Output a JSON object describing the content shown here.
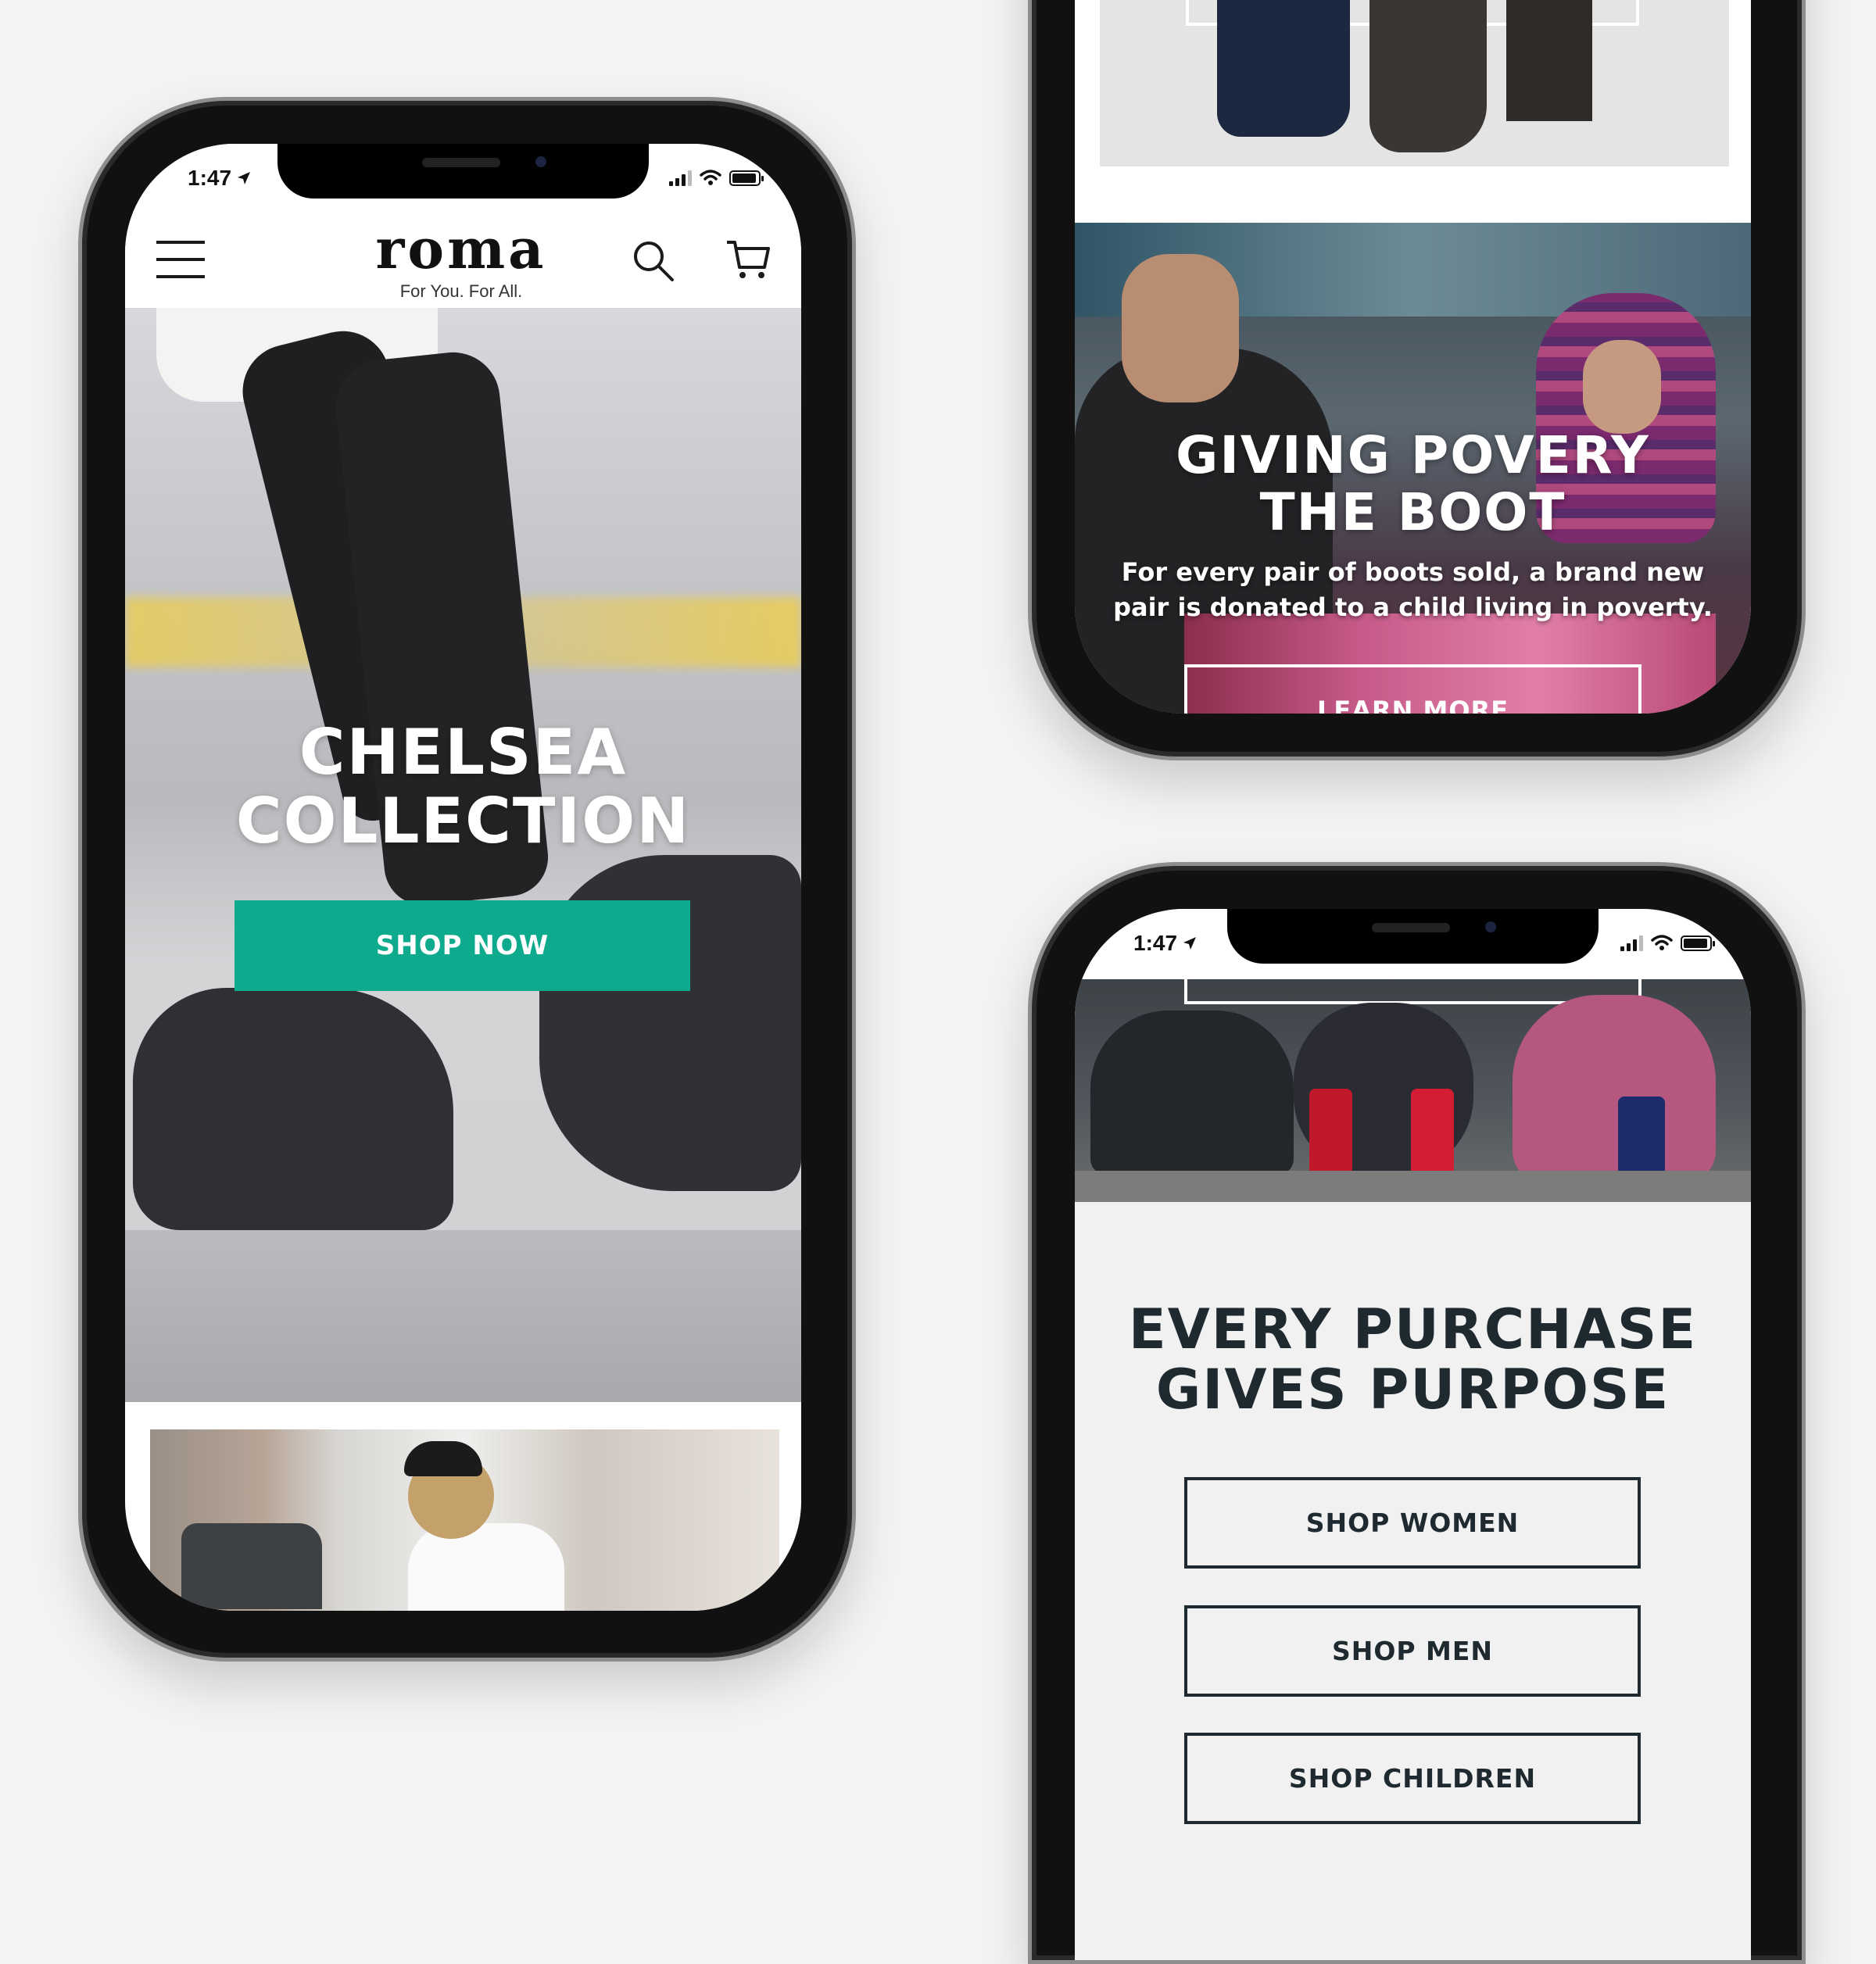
{
  "status": {
    "time": "1:47"
  },
  "header": {
    "logo": "roma",
    "tagline": "For You. For All."
  },
  "hero": {
    "title_line1": "CHELSEA",
    "title_line2": "COLLECTION",
    "cta_label": "SHOP NOW"
  },
  "giving": {
    "title_line1": "GIVING POVERY",
    "title_line2": "THE BOOT",
    "body_line1": "For every pair of boots sold, a brand new",
    "body_line2": "pair is donated to a child living in poverty.",
    "cta_label": "LEARN MORE"
  },
  "purpose": {
    "title_line1": "EVERY PURCHASE",
    "title_line2": "GIVES PURPOSE",
    "buttons": [
      {
        "label": "SHOP WOMEN"
      },
      {
        "label": "SHOP MEN"
      },
      {
        "label": "SHOP CHILDREN"
      }
    ]
  },
  "colors": {
    "background": "#f3f3f3",
    "accent": "#0eaa8d",
    "dark_text": "#1f2a30",
    "purpose_section_bg": "#f1f1f1"
  },
  "icons": [
    "menu-icon",
    "search-icon",
    "cart-icon",
    "location-arrow-icon",
    "signal-icon",
    "wifi-icon",
    "battery-icon"
  ]
}
